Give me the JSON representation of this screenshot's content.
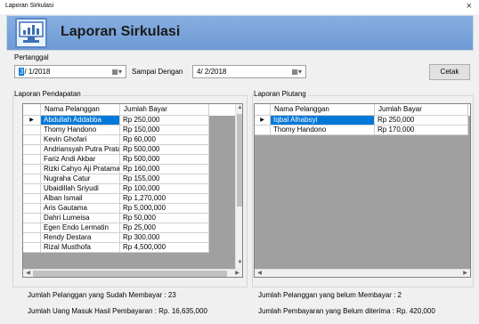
{
  "window": {
    "title": "Laporan Sirkulasi",
    "close_glyph": "×"
  },
  "banner": {
    "title": "Laporan Sirkulasi",
    "icon": "report-chart-icon",
    "bg_color": "#7aa4da"
  },
  "filter": {
    "from_label": "Pertanggal",
    "from_month": "3",
    "from_rest": "/ 1/2018",
    "to_label": "Sampai Dengan",
    "to_value": "4/ 2/2018",
    "print_button": "Cetak"
  },
  "income": {
    "title": "Laporan Pendapatan",
    "columns": [
      "Nama Pelanggan",
      "Jumlah Bayar"
    ],
    "rows": [
      [
        "Abdullah Addabba",
        "Rp 250,000"
      ],
      [
        "Thomy Handono",
        "Rp 150,000"
      ],
      [
        "Kevin Ghofari",
        "Rp 60,000"
      ],
      [
        "Andriansyah Putra Prata...",
        "Rp 500,000"
      ],
      [
        "Fariz Andi Akbar",
        "Rp 500,000"
      ],
      [
        "Rizki Cahyo Aji Pratama",
        "Rp 160,000"
      ],
      [
        "Nugraha Catur",
        "Rp 155,000"
      ],
      [
        "Ubaidillah Sriyudi",
        "Rp 100,000"
      ],
      [
        "Alban Ismail",
        "Rp 1,270,000"
      ],
      [
        "Aris Gautama",
        "Rp 5,000,000"
      ],
      [
        "Dahri Lumeisa",
        "Rp 50,000"
      ],
      [
        "Egen Endo Lermatin",
        "Rp 25,000"
      ],
      [
        "Rendy Destara",
        "Rp 300,000"
      ],
      [
        "Rizal Musthofa",
        "Rp 4,500,000"
      ]
    ],
    "selected_index": 0,
    "summary_count": "Jumlah Pelanggan yang Sudah Membayar : 23",
    "summary_total": "Jumlah Uang Masuk Hasil Pembayaran : Rp. 16,635,000"
  },
  "debt": {
    "title": "Laporan Piutang",
    "columns": [
      "Nama Pelanggan",
      "Jumlah Bayar"
    ],
    "rows": [
      [
        "Iqbal Alhabsyi",
        "Rp 250,000"
      ],
      [
        "Thomy Handono",
        "Rp 170,000"
      ]
    ],
    "selected_index": 0,
    "summary_count": "Jumlah Pelanggan yang belum Membayar : 2",
    "summary_total": "Jumlah Pembayaran yang Belum diterima : Rp. 420,000"
  },
  "colors": {
    "selection": "#0078d7",
    "grid_empty": "#a0a0a0"
  }
}
